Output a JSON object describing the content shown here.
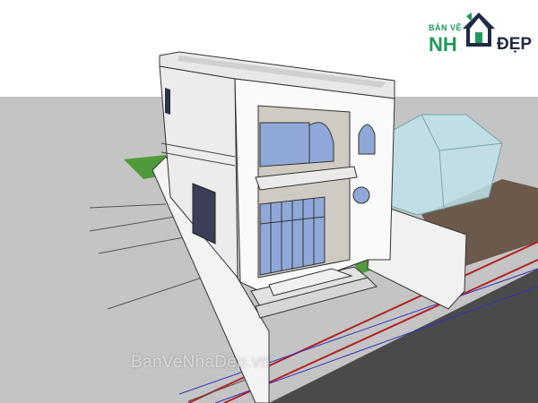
{
  "logo": {
    "line1": "BẢN VẼ",
    "left": "NH",
    "right": "ĐẸP",
    "icon": "house-logo-icon",
    "colors": {
      "green": "#1e9a5a",
      "navy": "#1f2a44"
    }
  },
  "watermark": {
    "text": "BanVeNhaDep.vn"
  },
  "scene": {
    "subject": "3d-sketchup-model-two-storey-house",
    "colors": {
      "ground": "#c4c4c4",
      "road": "#4a4a4a",
      "wall": "#fafafa",
      "glass": "#8fa8d8",
      "neighbor_house": "#bfe3ea",
      "grass": "#4f9a3c"
    }
  }
}
